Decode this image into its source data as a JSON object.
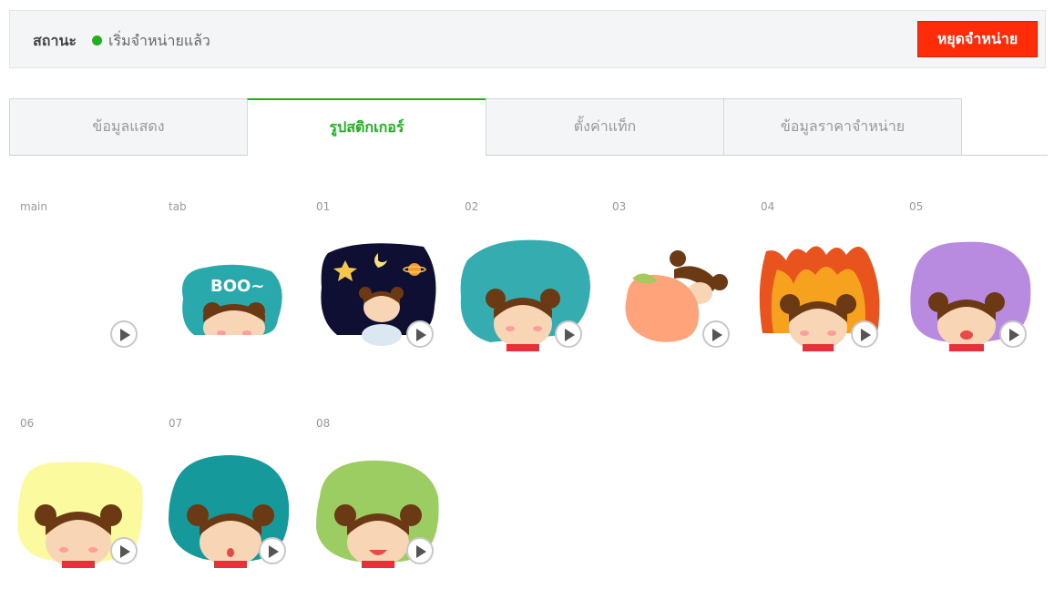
{
  "status": {
    "label": "สถานะ",
    "value": "เริ่มจำหน่ายแล้ว",
    "dot_color": "#1fb122",
    "stop_button": "หยุดจำหน่าย"
  },
  "tabs": [
    {
      "label": "ข้อมูลแสดง",
      "active": false
    },
    {
      "label": "รูปสติกเกอร์",
      "active": true
    },
    {
      "label": "ตั้งค่าแท็ก",
      "active": false
    },
    {
      "label": "ข้อมูลราคาจำหน่าย",
      "active": false
    }
  ],
  "stickers": [
    {
      "label": "main",
      "background": ""
    },
    {
      "label": "tab",
      "background": "#2aa9ad",
      "text": "BOO~"
    },
    {
      "label": "01",
      "background": "#0e0f33"
    },
    {
      "label": "02",
      "background": "#35adb0"
    },
    {
      "label": "03",
      "background": "#ffa47a"
    },
    {
      "label": "04",
      "background": "#f07a1e"
    },
    {
      "label": "05",
      "background": "#b98be0"
    },
    {
      "label": "06",
      "background": "#fbfa9e"
    },
    {
      "label": "07",
      "background": "#16999b"
    },
    {
      "label": "08",
      "background": "#9ccd63"
    }
  ],
  "icons": {
    "play": "play-icon",
    "status": "status-dot-icon"
  }
}
